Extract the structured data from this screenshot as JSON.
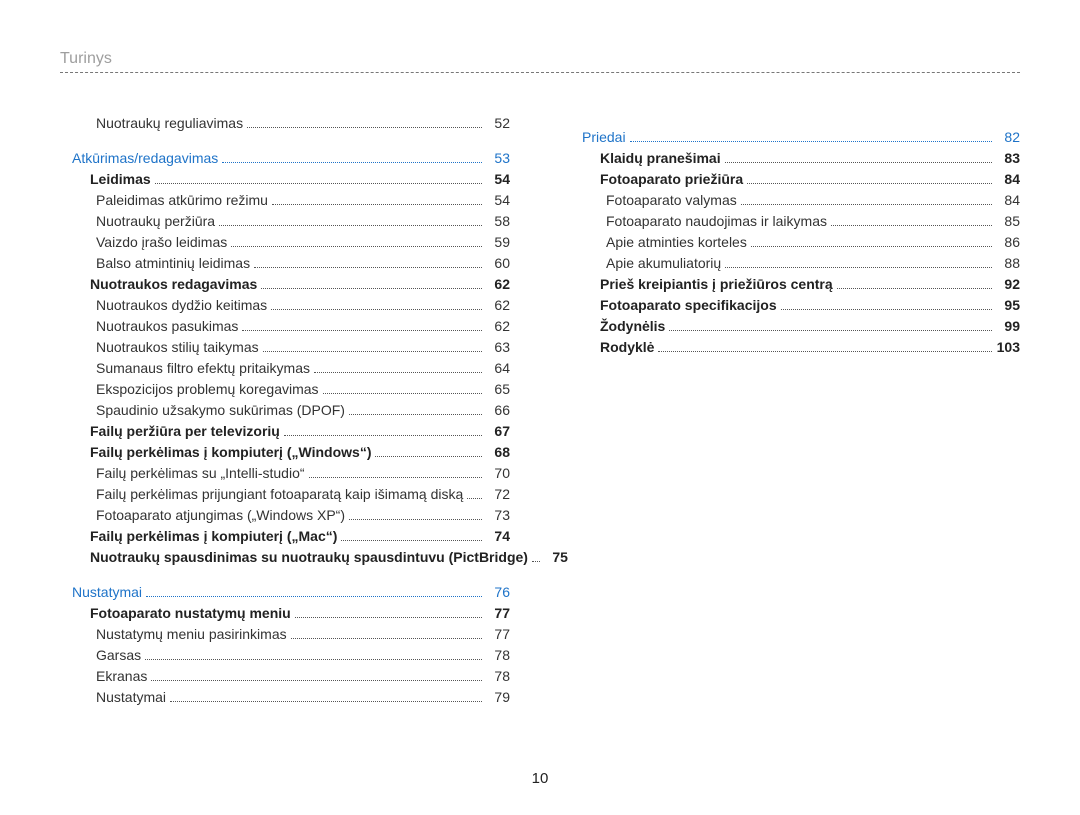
{
  "header": {
    "title": "Turinys"
  },
  "footer": {
    "pageNumber": "10"
  },
  "leftColumn": [
    {
      "label": "Nuotraukų reguliavimas",
      "page": "52",
      "style": "plain",
      "indent": 2
    },
    {
      "label": "Atkūrimas/redagavimas",
      "page": "53",
      "style": "section",
      "indent": 0
    },
    {
      "label": "Leidimas",
      "page": "54",
      "style": "bold",
      "indent": 1
    },
    {
      "label": "Paleidimas atkūrimo režimu",
      "page": "54",
      "style": "plain",
      "indent": 2
    },
    {
      "label": "Nuotraukų peržiūra",
      "page": "58",
      "style": "plain",
      "indent": 2
    },
    {
      "label": "Vaizdo įrašo leidimas",
      "page": "59",
      "style": "plain",
      "indent": 2
    },
    {
      "label": "Balso atmintinių leidimas",
      "page": "60",
      "style": "plain",
      "indent": 2
    },
    {
      "label": "Nuotraukos redagavimas",
      "page": "62",
      "style": "bold",
      "indent": 1
    },
    {
      "label": "Nuotraukos dydžio keitimas",
      "page": "62",
      "style": "plain",
      "indent": 2
    },
    {
      "label": "Nuotraukos pasukimas",
      "page": "62",
      "style": "plain",
      "indent": 2
    },
    {
      "label": "Nuotraukos stilių taikymas",
      "page": "63",
      "style": "plain",
      "indent": 2
    },
    {
      "label": "Sumanaus filtro efektų pritaikymas",
      "page": "64",
      "style": "plain",
      "indent": 2
    },
    {
      "label": "Ekspozicijos problemų koregavimas",
      "page": "65",
      "style": "plain",
      "indent": 2
    },
    {
      "label": "Spaudinio užsakymo sukūrimas (DPOF)",
      "page": "66",
      "style": "plain",
      "indent": 2
    },
    {
      "label": "Failų peržiūra per televizorių",
      "page": "67",
      "style": "bold",
      "indent": 1
    },
    {
      "label": "Failų perkėlimas į kompiuterį („Windows“)",
      "page": "68",
      "style": "bold",
      "indent": 1
    },
    {
      "label": "Failų perkėlimas su „Intelli-studio“",
      "page": "70",
      "style": "plain",
      "indent": 2
    },
    {
      "label": "Failų perkėlimas prijungiant fotoaparatą kaip išimamą diską",
      "page": "72",
      "style": "plain",
      "indent": 2
    },
    {
      "label": "Fotoaparato atjungimas („Windows XP“)",
      "page": "73",
      "style": "plain",
      "indent": 2
    },
    {
      "label": "Failų perkėlimas į kompiuterį („Mac“)",
      "page": "74",
      "style": "bold",
      "indent": 1
    },
    {
      "label": "Nuotraukų spausdinimas su nuotraukų spausdintuvu (PictBridge)",
      "page": "75",
      "style": "bold",
      "indent": 1,
      "wrap": true
    },
    {
      "label": "Nustatymai",
      "page": "76",
      "style": "section",
      "indent": 0
    },
    {
      "label": "Fotoaparato nustatymų meniu",
      "page": "77",
      "style": "bold",
      "indent": 1
    },
    {
      "label": "Nustatymų meniu pasirinkimas",
      "page": "77",
      "style": "plain",
      "indent": 2
    },
    {
      "label": "Garsas",
      "page": "78",
      "style": "plain",
      "indent": 2
    },
    {
      "label": "Ekranas",
      "page": "78",
      "style": "plain",
      "indent": 2
    },
    {
      "label": "Nustatymai",
      "page": "79",
      "style": "plain",
      "indent": 2
    }
  ],
  "rightColumn": [
    {
      "label": "Priedai",
      "page": "82",
      "style": "section",
      "indent": 0
    },
    {
      "label": "Klaidų pranešimai",
      "page": "83",
      "style": "bold",
      "indent": 1
    },
    {
      "label": "Fotoaparato priežiūra",
      "page": "84",
      "style": "bold",
      "indent": 1
    },
    {
      "label": "Fotoaparato valymas",
      "page": "84",
      "style": "plain",
      "indent": 2
    },
    {
      "label": "Fotoaparato naudojimas ir laikymas",
      "page": "85",
      "style": "plain",
      "indent": 2
    },
    {
      "label": "Apie atminties korteles",
      "page": "86",
      "style": "plain",
      "indent": 2
    },
    {
      "label": "Apie akumuliatorių",
      "page": "88",
      "style": "plain",
      "indent": 2
    },
    {
      "label": "Prieš kreipiantis į priežiūros centrą",
      "page": "92",
      "style": "bold",
      "indent": 1
    },
    {
      "label": "Fotoaparato specifikacijos",
      "page": "95",
      "style": "bold",
      "indent": 1
    },
    {
      "label": "Žodynėlis",
      "page": "99",
      "style": "bold",
      "indent": 1
    },
    {
      "label": "Rodyklė",
      "page": "103",
      "style": "bold",
      "indent": 1
    }
  ]
}
